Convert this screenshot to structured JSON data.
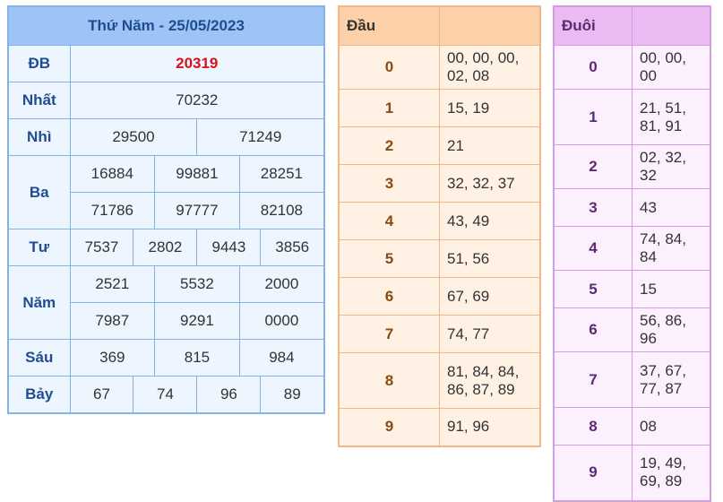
{
  "results": {
    "title": "Thứ Năm - 25/05/2023",
    "db": {
      "label": "ĐB",
      "values": [
        "20319"
      ]
    },
    "nhat": {
      "label": "Nhất",
      "values": [
        "70232"
      ]
    },
    "nhi": {
      "label": "Nhì",
      "values": [
        "29500",
        "71249"
      ]
    },
    "ba": {
      "label": "Ba",
      "rows": [
        [
          "16884",
          "99881",
          "28251"
        ],
        [
          "71786",
          "97777",
          "82108"
        ]
      ]
    },
    "tu": {
      "label": "Tư",
      "values": [
        "7537",
        "2802",
        "9443",
        "3856"
      ]
    },
    "nam": {
      "label": "Năm",
      "rows": [
        [
          "2521",
          "5532",
          "2000"
        ],
        [
          "7987",
          "9291",
          "0000"
        ]
      ]
    },
    "sau": {
      "label": "Sáu",
      "values": [
        "369",
        "815",
        "984"
      ]
    },
    "bay": {
      "label": "Bảy",
      "values": [
        "67",
        "74",
        "96",
        "89"
      ]
    }
  },
  "head": {
    "title": "Đầu",
    "rows": [
      {
        "k": "0",
        "v": "00, 00, 00, 02, 08"
      },
      {
        "k": "1",
        "v": "15, 19"
      },
      {
        "k": "2",
        "v": "21"
      },
      {
        "k": "3",
        "v": "32, 32, 37"
      },
      {
        "k": "4",
        "v": "43, 49"
      },
      {
        "k": "5",
        "v": "51, 56"
      },
      {
        "k": "6",
        "v": "67, 69"
      },
      {
        "k": "7",
        "v": "74, 77"
      },
      {
        "k": "8",
        "v": "81, 84, 84, 86, 87, 89"
      },
      {
        "k": "9",
        "v": "91, 96"
      }
    ]
  },
  "tail": {
    "title": "Đuôi",
    "rows": [
      {
        "k": "0",
        "v": "00, 00, 00"
      },
      {
        "k": "1",
        "v": "21, 51, 81, 91"
      },
      {
        "k": "2",
        "v": "02, 32, 32"
      },
      {
        "k": "3",
        "v": "43"
      },
      {
        "k": "4",
        "v": "74, 84, 84"
      },
      {
        "k": "5",
        "v": "15"
      },
      {
        "k": "6",
        "v": "56, 86, 96"
      },
      {
        "k": "7",
        "v": "37, 67, 77, 87"
      },
      {
        "k": "8",
        "v": "08"
      },
      {
        "k": "9",
        "v": "19, 49, 69, 89"
      }
    ]
  },
  "colors": {
    "results_header": "#9dc3f7",
    "results_border": "#86b3e6",
    "special_prize": "#d8121a",
    "head_header": "#fcd0a8",
    "tail_header": "#ebbaf3"
  }
}
